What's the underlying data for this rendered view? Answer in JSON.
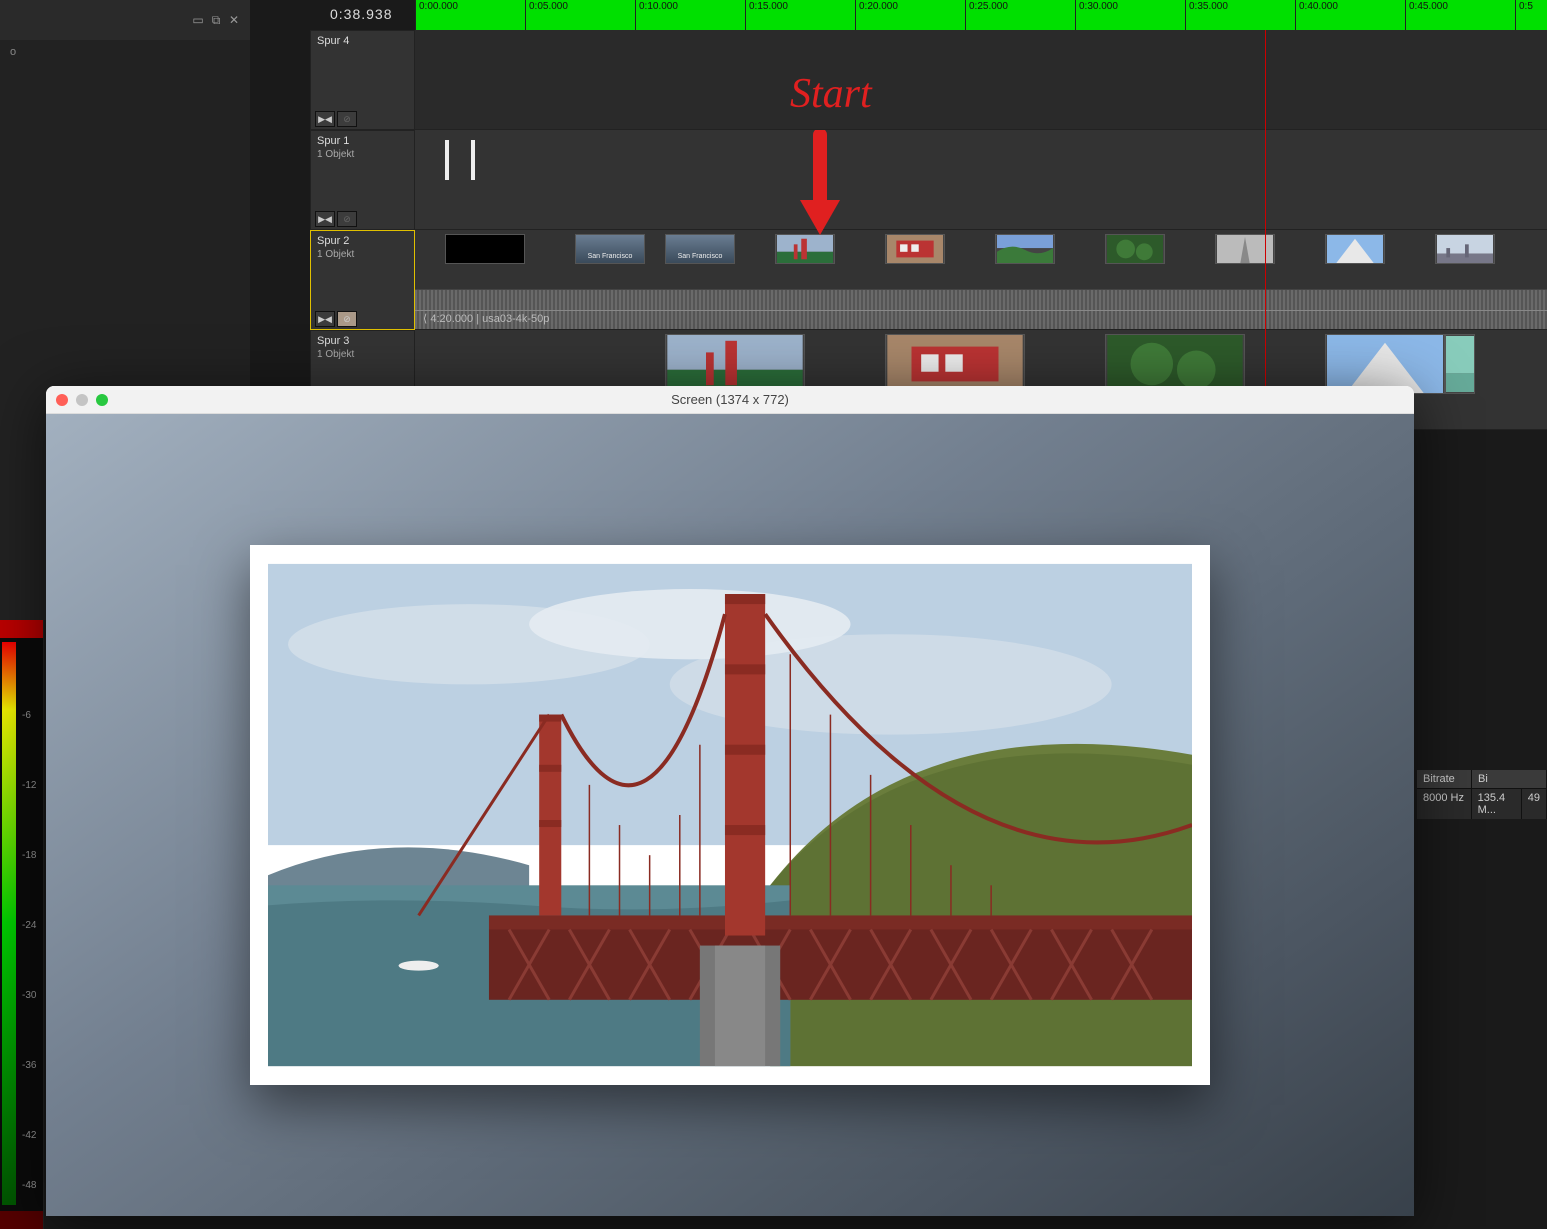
{
  "timecode": "0:38.938",
  "ruler_ticks": [
    "0:00.000",
    "0:05.000",
    "0:10.000",
    "0:15.000",
    "0:20.000",
    "0:25.000",
    "0:30.000",
    "0:35.000",
    "0:40.000",
    "0:45.000",
    "0:5"
  ],
  "tracks": [
    {
      "name": "Spur 4",
      "sub": ""
    },
    {
      "name": "Spur 1",
      "sub": "1 Objekt"
    },
    {
      "name": "Spur 2",
      "sub": "1 Objekt"
    },
    {
      "name": "Spur 3",
      "sub": "1 Objekt"
    }
  ],
  "lane2_status": "⟨  4:20.000 | usa03-4k-50p",
  "annotation": "Start",
  "preview": {
    "title": "Screen (1374 x 772)"
  },
  "info": {
    "headers": [
      "Bitrate",
      "Bi"
    ],
    "row": [
      "8000 Hz",
      "135.4 M...",
      "49"
    ]
  },
  "meter_labels": [
    "-6",
    "-12",
    "-18",
    "-24",
    "-30",
    "-36",
    "-42",
    "-48"
  ],
  "meter_bottom": "",
  "title_cards": [
    "San Francisco",
    "San Francisco"
  ]
}
